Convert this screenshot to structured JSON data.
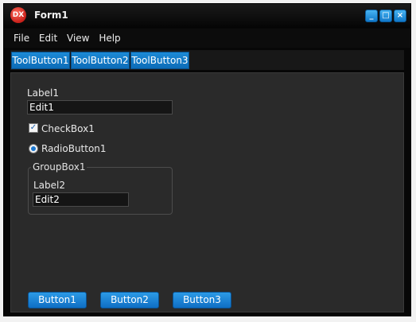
{
  "window": {
    "title": "Form1",
    "app_icon_text": "DX",
    "minimize_glyph": "_",
    "maximize_glyph": "□",
    "close_glyph": "×"
  },
  "menu": {
    "items": [
      "File",
      "Edit",
      "View",
      "Help"
    ]
  },
  "toolbar": {
    "buttons": [
      "ToolButton1",
      "ToolButton2",
      "ToolButton3"
    ]
  },
  "form": {
    "label1": "Label1",
    "edit1_value": "Edit1",
    "checkbox1_label": "CheckBox1",
    "checkbox1_checked": true,
    "check_glyph": "✓",
    "radio1_label": "RadioButton1",
    "radio1_selected": true,
    "groupbox1_title": "GroupBox1",
    "label2": "Label2",
    "edit2_value": "Edit2"
  },
  "buttons": {
    "button1": "Button1",
    "button2": "Button2",
    "button3": "Button3"
  },
  "colors": {
    "accent": "#1c8ad6",
    "window_bg": "#070707",
    "client_bg": "#2a2a2a"
  }
}
